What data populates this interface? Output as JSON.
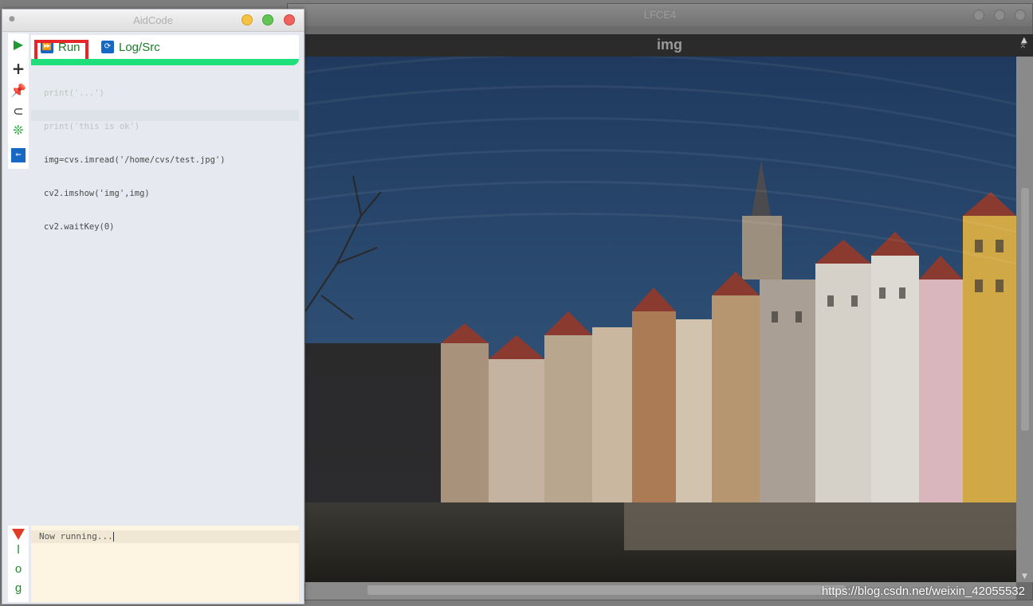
{
  "background_window": {
    "title": "LFCE4",
    "image_window_title": "img",
    "image_subject": "riverside town houses under blue sky"
  },
  "watermark": "https://blog.csdn.net/weixin_42055532",
  "aidcode": {
    "title": "AidCode",
    "toolbar_icons": [
      "run-icon",
      "add-icon",
      "pin-icon",
      "attach-icon",
      "settings-icon",
      "back-icon"
    ],
    "tabs": [
      {
        "label": "Run",
        "icon": "run-tab-icon"
      },
      {
        "label": "Log/Src",
        "icon": "refresh-icon"
      }
    ],
    "code_lines": [
      "print('...')",
      "print('this is ok')",
      "img=cvs.imread('/home/cvs/test.jpg')",
      "cv2.imshow('img',img)",
      "cv2.waitKey(0)"
    ],
    "log": {
      "letters": [
        "l",
        "o",
        "g"
      ],
      "text": "Now running..."
    }
  },
  "colors": {
    "accent_green": "#1de07a",
    "highlight_red": "#e8262a",
    "log_bg": "#fdf4e1"
  }
}
